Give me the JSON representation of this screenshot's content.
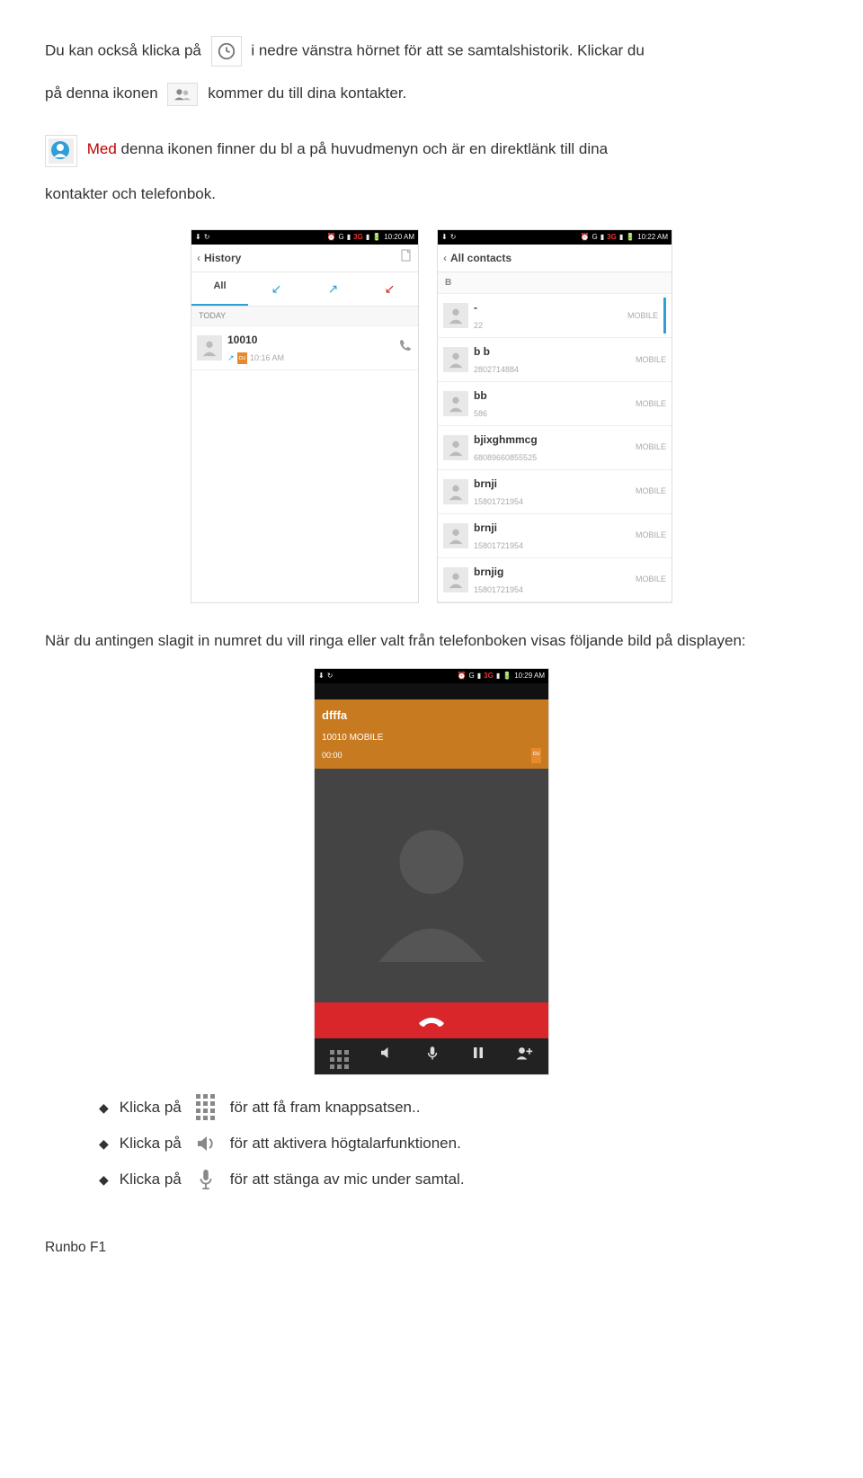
{
  "text": {
    "p1a": "Du kan också klicka på",
    "p1b": "i nedre vänstra hörnet för att se samtalshistorik. Klickar du",
    "p2a": "på denna ikonen",
    "p2b": "kommer du till dina kontakter.",
    "p3_red": "Med",
    "p3_rest": "denna ikonen finner du bl a på huvudmenyn och är en direktlänk till dina",
    "p3_cont": "kontakter och telefonbok.",
    "p4": "När du antingen slagit in numret du vill ringa eller valt från telefonboken visas följande bild på displayen:",
    "bullet1a": "Klicka på",
    "bullet1b": "för att få fram knappsatsen..",
    "bullet2a": "Klicka på",
    "bullet2b": "för att aktivera högtalarfunktionen.",
    "bullet3a": "Klicka på",
    "bullet3b": "för att stänga av mic under samtal.",
    "footer": "Runbo F1"
  },
  "screenA": {
    "time": "10:20 AM",
    "header": "History",
    "tabs": {
      "all": "All"
    },
    "today_label": "TODAY",
    "row": {
      "name": "10010",
      "cu": "cu",
      "sub": "10:16 AM"
    }
  },
  "screenB": {
    "time": "10:22 AM",
    "header": "All contacts",
    "index": "B",
    "rows": [
      {
        "name": "-",
        "sub": "22",
        "badge": "MOBILE",
        "highlight": true
      },
      {
        "name": "b b",
        "sub": "2802714884",
        "badge": "MOBILE"
      },
      {
        "name": "bb",
        "sub": "586",
        "badge": "MOBILE"
      },
      {
        "name": "bjixghmmcg",
        "sub": "68089660855525",
        "badge": "MOBILE"
      },
      {
        "name": "brnji",
        "sub": "15801721954",
        "badge": "MOBILE"
      },
      {
        "name": "brnji",
        "sub": "15801721954",
        "badge": "MOBILE"
      },
      {
        "name": "brnjig",
        "sub": "15801721954",
        "badge": "MOBILE"
      }
    ]
  },
  "screenC": {
    "time": "10:29 AM",
    "name": "dfffa",
    "sub": "10010 MOBILE",
    "duration": "00:00",
    "cu": "cu"
  }
}
